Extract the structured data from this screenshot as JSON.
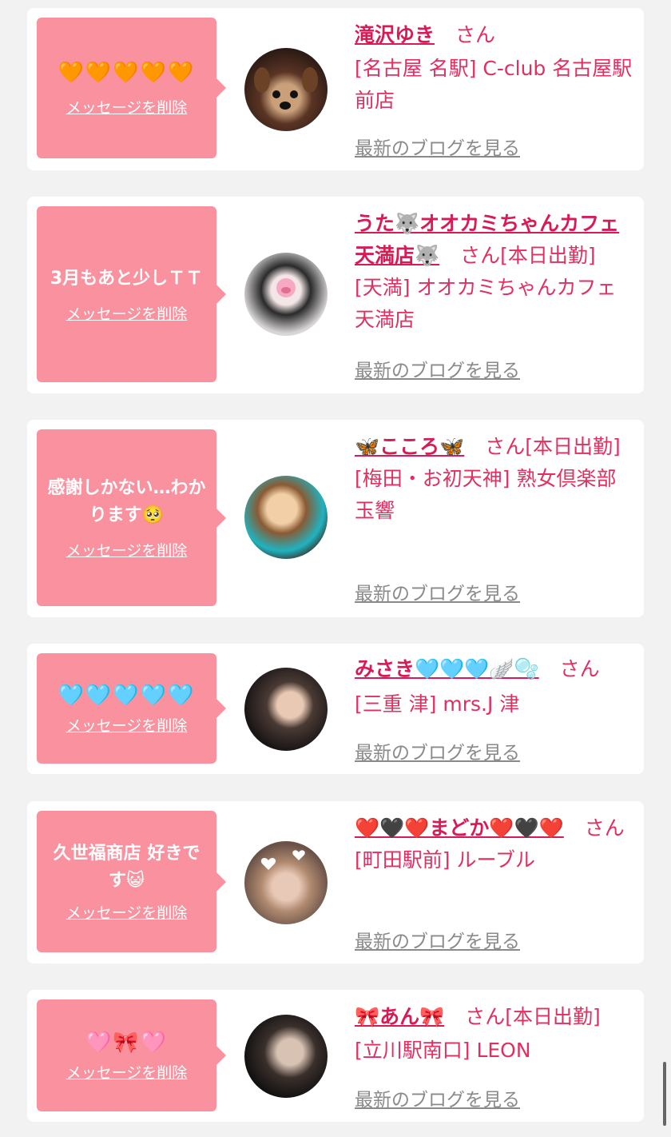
{
  "delete_label": "メッセージを削除",
  "blog_label": "最新のブログを見る",
  "colors": {
    "bubble": "#f9919e",
    "name": "#d81b54",
    "shop": "#e03060",
    "link_gray": "#8a8a8a"
  },
  "items": [
    {
      "message": "🧡🧡🧡🧡🧡",
      "name": "滝沢ゆき",
      "suffix": "さん",
      "shop": "[名古屋 名駅] C-club 名古屋駅前店"
    },
    {
      "message": "3月もあと少しＴＴ",
      "name": "うた🐺オオカミちゃんカフェ天満店🐺",
      "suffix": "さん[本日出勤]",
      "shop": "[天満] オオカミちゃんカフェ天満店"
    },
    {
      "message": "感謝しかない…わかります🥺",
      "name": "🦋こころ🦋",
      "suffix": "さん[本日出勤]",
      "shop": "[梅田・お初天神] 熟女倶楽部 玉響"
    },
    {
      "message": "🩵🩵🩵🩵🩵",
      "name": "みさき🩵🩵🩵🪽🫧",
      "suffix": "さん",
      "shop": "[三重 津] mrs.J 津"
    },
    {
      "message": "久世福商店 好きです😺",
      "name": "❤️🖤❤️まどか❤️🖤❤️",
      "suffix": "さん",
      "shop": "[町田駅前] ルーブル"
    },
    {
      "message": "🩷🎀🩷",
      "name": "🎀あん🎀",
      "suffix": "さん[本日出勤]",
      "shop": "[立川駅南口] LEON"
    }
  ]
}
